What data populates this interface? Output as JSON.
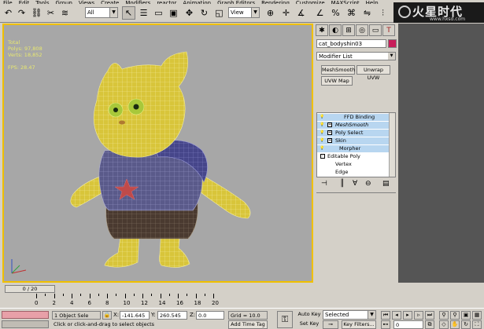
{
  "menu": {
    "items": [
      "File",
      "Edit",
      "Tools",
      "Group",
      "Views",
      "Create",
      "Modifiers",
      "reactor",
      "Animation",
      "Graph Editors",
      "Rendering",
      "Customize",
      "MAXScript",
      "Help"
    ]
  },
  "toolbar": {
    "selection_filter": "All",
    "ref_coord": "View"
  },
  "logo": {
    "text": "火星时代",
    "url": "www.hxsd.com"
  },
  "viewport": {
    "stats": [
      "Total",
      "Polys: 97,808",
      "Verts: 18,852",
      "",
      "FPS: 28.47"
    ]
  },
  "command_panel": {
    "object_name": "cat_bodyshin03",
    "object_color": "#c81e5a",
    "modifier_list_label": "Modifier List",
    "buttons": [
      "MeshSmooth",
      "Unwrap UVW",
      "UVW Map"
    ],
    "stack": [
      {
        "label": "FFD Binding (WSM)",
        "bulb": true,
        "expand": "",
        "highlight": true
      },
      {
        "label": "MeshSmooth",
        "bulb": true,
        "expand": "+",
        "highlight": true
      },
      {
        "label": "Poly Select",
        "bulb": true,
        "expand": "+",
        "highlight": true
      },
      {
        "label": "Skin",
        "bulb": true,
        "expand": "+",
        "highlight": true
      },
      {
        "label": "Morpher",
        "bulb": true,
        "expand": "",
        "highlight": true
      },
      {
        "label": "Editable Poly",
        "bulb": false,
        "expand": "-",
        "highlight": false
      },
      {
        "label": "Vertex",
        "bulb": false,
        "expand": "",
        "highlight": false,
        "indent": true
      },
      {
        "label": "Edge",
        "bulb": false,
        "expand": "",
        "highlight": false,
        "indent": true
      }
    ]
  },
  "timeline": {
    "slider_label": "0 / 20",
    "ticks": [
      "0",
      "2",
      "4",
      "6",
      "8",
      "10",
      "12",
      "14",
      "16",
      "18",
      "20"
    ]
  },
  "status": {
    "selection_count": "1 Object Sele",
    "prompt": "Click or click-and-drag to select objects",
    "x_label": "X:",
    "x_value": "-141.645",
    "y_label": "Y:",
    "y_value": "260.545",
    "z_label": "Z:",
    "z_value": "0.0",
    "grid": "Grid = 10.0",
    "add_time_tag": "Add Time Tag",
    "auto_key": "Auto Key",
    "selected": "Selected",
    "set_key": "Set Key",
    "key_filters": "Key Filters...",
    "frame": "0"
  }
}
